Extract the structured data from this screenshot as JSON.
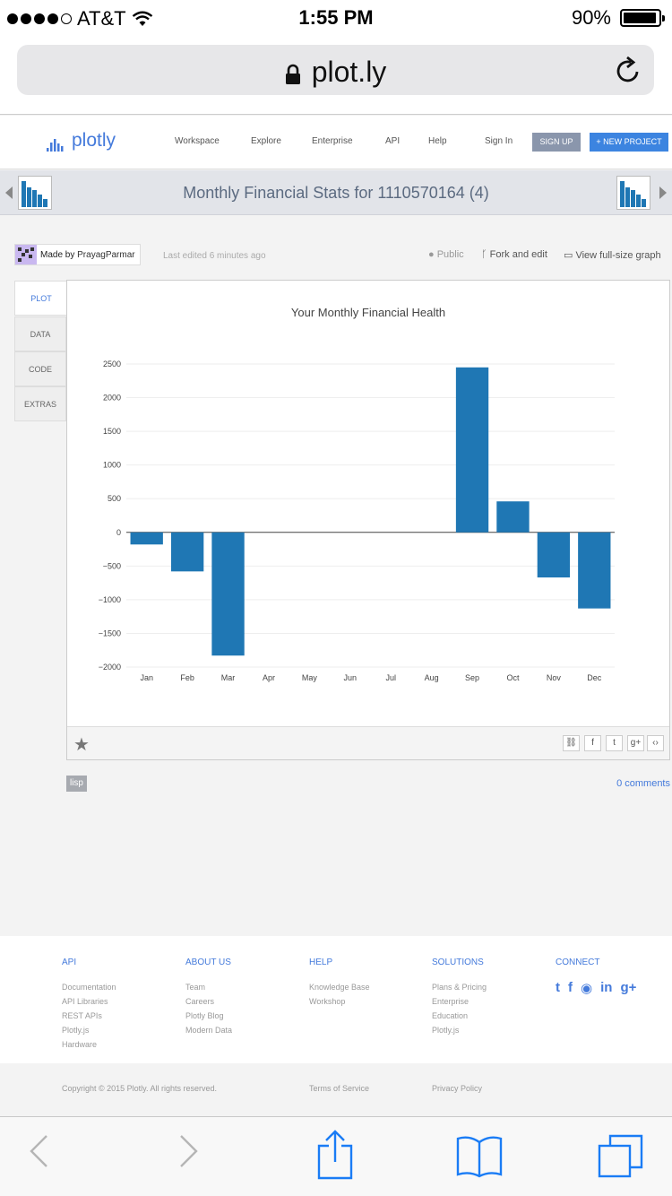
{
  "status": {
    "carrier": "AT&T",
    "time": "1:55 PM",
    "battery": "90%"
  },
  "browser": {
    "url": "plot.ly"
  },
  "nav": {
    "logo": "plotly",
    "links": [
      "Workspace",
      "Explore",
      "Enterprise",
      "API",
      "Help",
      "Sign In"
    ],
    "signup": "SIGN UP",
    "new_project": "+ NEW PROJECT"
  },
  "page": {
    "title": "Monthly Financial Stats for 1110570164 (4)",
    "made_by_prefix": "Made by",
    "author": "PrayagParmar",
    "last_edited": "Last edited 6 minutes ago",
    "public": "Public",
    "fork": "Fork and edit",
    "fullsize": "View full-size graph",
    "tabs": [
      "PLOT",
      "DATA",
      "CODE",
      "EXTRAS"
    ],
    "tag": "lisp",
    "comments": "0 comments"
  },
  "chart_data": {
    "type": "bar",
    "title": "Your Monthly Financial Health",
    "categories": [
      "Jan",
      "Feb",
      "Mar",
      "Apr",
      "May",
      "Jun",
      "Jul",
      "Aug",
      "Sep",
      "Oct",
      "Nov",
      "Dec"
    ],
    "values": [
      -180,
      -580,
      -1830,
      0,
      0,
      0,
      0,
      0,
      2450,
      460,
      -670,
      -1130
    ],
    "ylim": [
      -2000,
      2500
    ],
    "yticks": [
      2500,
      2000,
      1500,
      1000,
      500,
      0,
      -500,
      -1000,
      -1500,
      -2000
    ],
    "ytick_labels": [
      "2500",
      "2000",
      "1500",
      "1000",
      "500",
      "0",
      "−500",
      "−1000",
      "−1500",
      "−2000"
    ],
    "color": "#1f77b4",
    "grid": true
  },
  "footer": {
    "cols": [
      {
        "head": "API",
        "items": [
          "Documentation",
          "API Libraries",
          "REST APIs",
          "Plotly.js",
          "Hardware"
        ]
      },
      {
        "head": "ABOUT US",
        "items": [
          "Team",
          "Careers",
          "Plotly Blog",
          "Modern Data"
        ]
      },
      {
        "head": "HELP",
        "items": [
          "Knowledge Base",
          "Workshop"
        ]
      },
      {
        "head": "SOLUTIONS",
        "items": [
          "Plans & Pricing",
          "Enterprise",
          "Education",
          "Plotly.js"
        ]
      },
      {
        "head": "CONNECT",
        "items": []
      }
    ],
    "copyright": "Copyright © 2015 Plotly. All rights reserved.",
    "terms": "Terms of Service",
    "privacy": "Privacy Policy"
  },
  "colors": {
    "accent": "#447adb",
    "bar": "#1f77b4"
  }
}
